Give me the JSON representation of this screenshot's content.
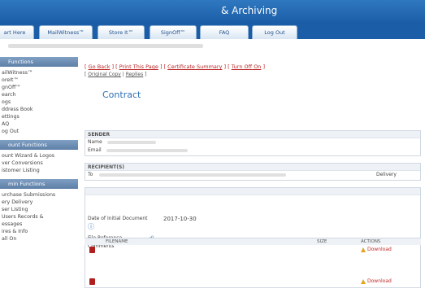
{
  "header": {
    "tagline": "",
    "brand": "& Archiving"
  },
  "tabs": [
    {
      "label": "art Here"
    },
    {
      "label": "MailWitness™"
    },
    {
      "label": "Store It™"
    },
    {
      "label": "SignOff™"
    },
    {
      "label": "FAQ"
    },
    {
      "label": "Log Out"
    }
  ],
  "breadcrumb": "",
  "sidebar": {
    "section1": {
      "title": "Functions",
      "items": [
        "ailWitness™",
        "oreIt™",
        "gnOff™",
        "earch",
        "ogs",
        "ddress Book",
        "ettings",
        "AQ",
        "og Out"
      ]
    },
    "section2": {
      "title": "ount Functions",
      "items": [
        "ount Wizard & Logos",
        "ver Conversions",
        "istomer Listing"
      ]
    },
    "section3": {
      "title": "min Functions",
      "items": [
        "urchase Submissions",
        "ery Delivery",
        "ser Listing",
        "Users Records &",
        "essages",
        "ires & Info",
        "all On"
      ]
    }
  },
  "main": {
    "links": [
      "Go Back",
      "Print This Page",
      "Certificate Summary",
      "Turn Off On"
    ],
    "sublinks": [
      "Original Copy",
      "Replies"
    ],
    "title": "Contract",
    "sender": {
      "head": "SENDER",
      "name_label": "Name",
      "email_label": "Email"
    },
    "recipients": {
      "head": "RECIPIENT(S)",
      "to_label": "To",
      "status": "Delivery"
    },
    "fields": {
      "head": "",
      "field1_label": "",
      "field1_value": "",
      "date_label": "Date of Initial Document",
      "date_value": "2017-10-30",
      "file_ref_label": "File Reference",
      "file_ref_value": "",
      "comments_label": "Comments",
      "comments_value": ""
    }
  },
  "files": {
    "col_file": "FILENAME",
    "col_size": "SIZE",
    "col_actions": "ACTIONS",
    "rows": [
      {
        "name": "",
        "size": "",
        "action": "Download"
      },
      {
        "name": "",
        "size": "",
        "action": "Download"
      }
    ],
    "detail1": "",
    "detail2": "",
    "detail3": ""
  },
  "colors": {
    "accent": "#1b5ea7",
    "link_red": "#b22222",
    "title_blue": "#2d6fb3"
  }
}
